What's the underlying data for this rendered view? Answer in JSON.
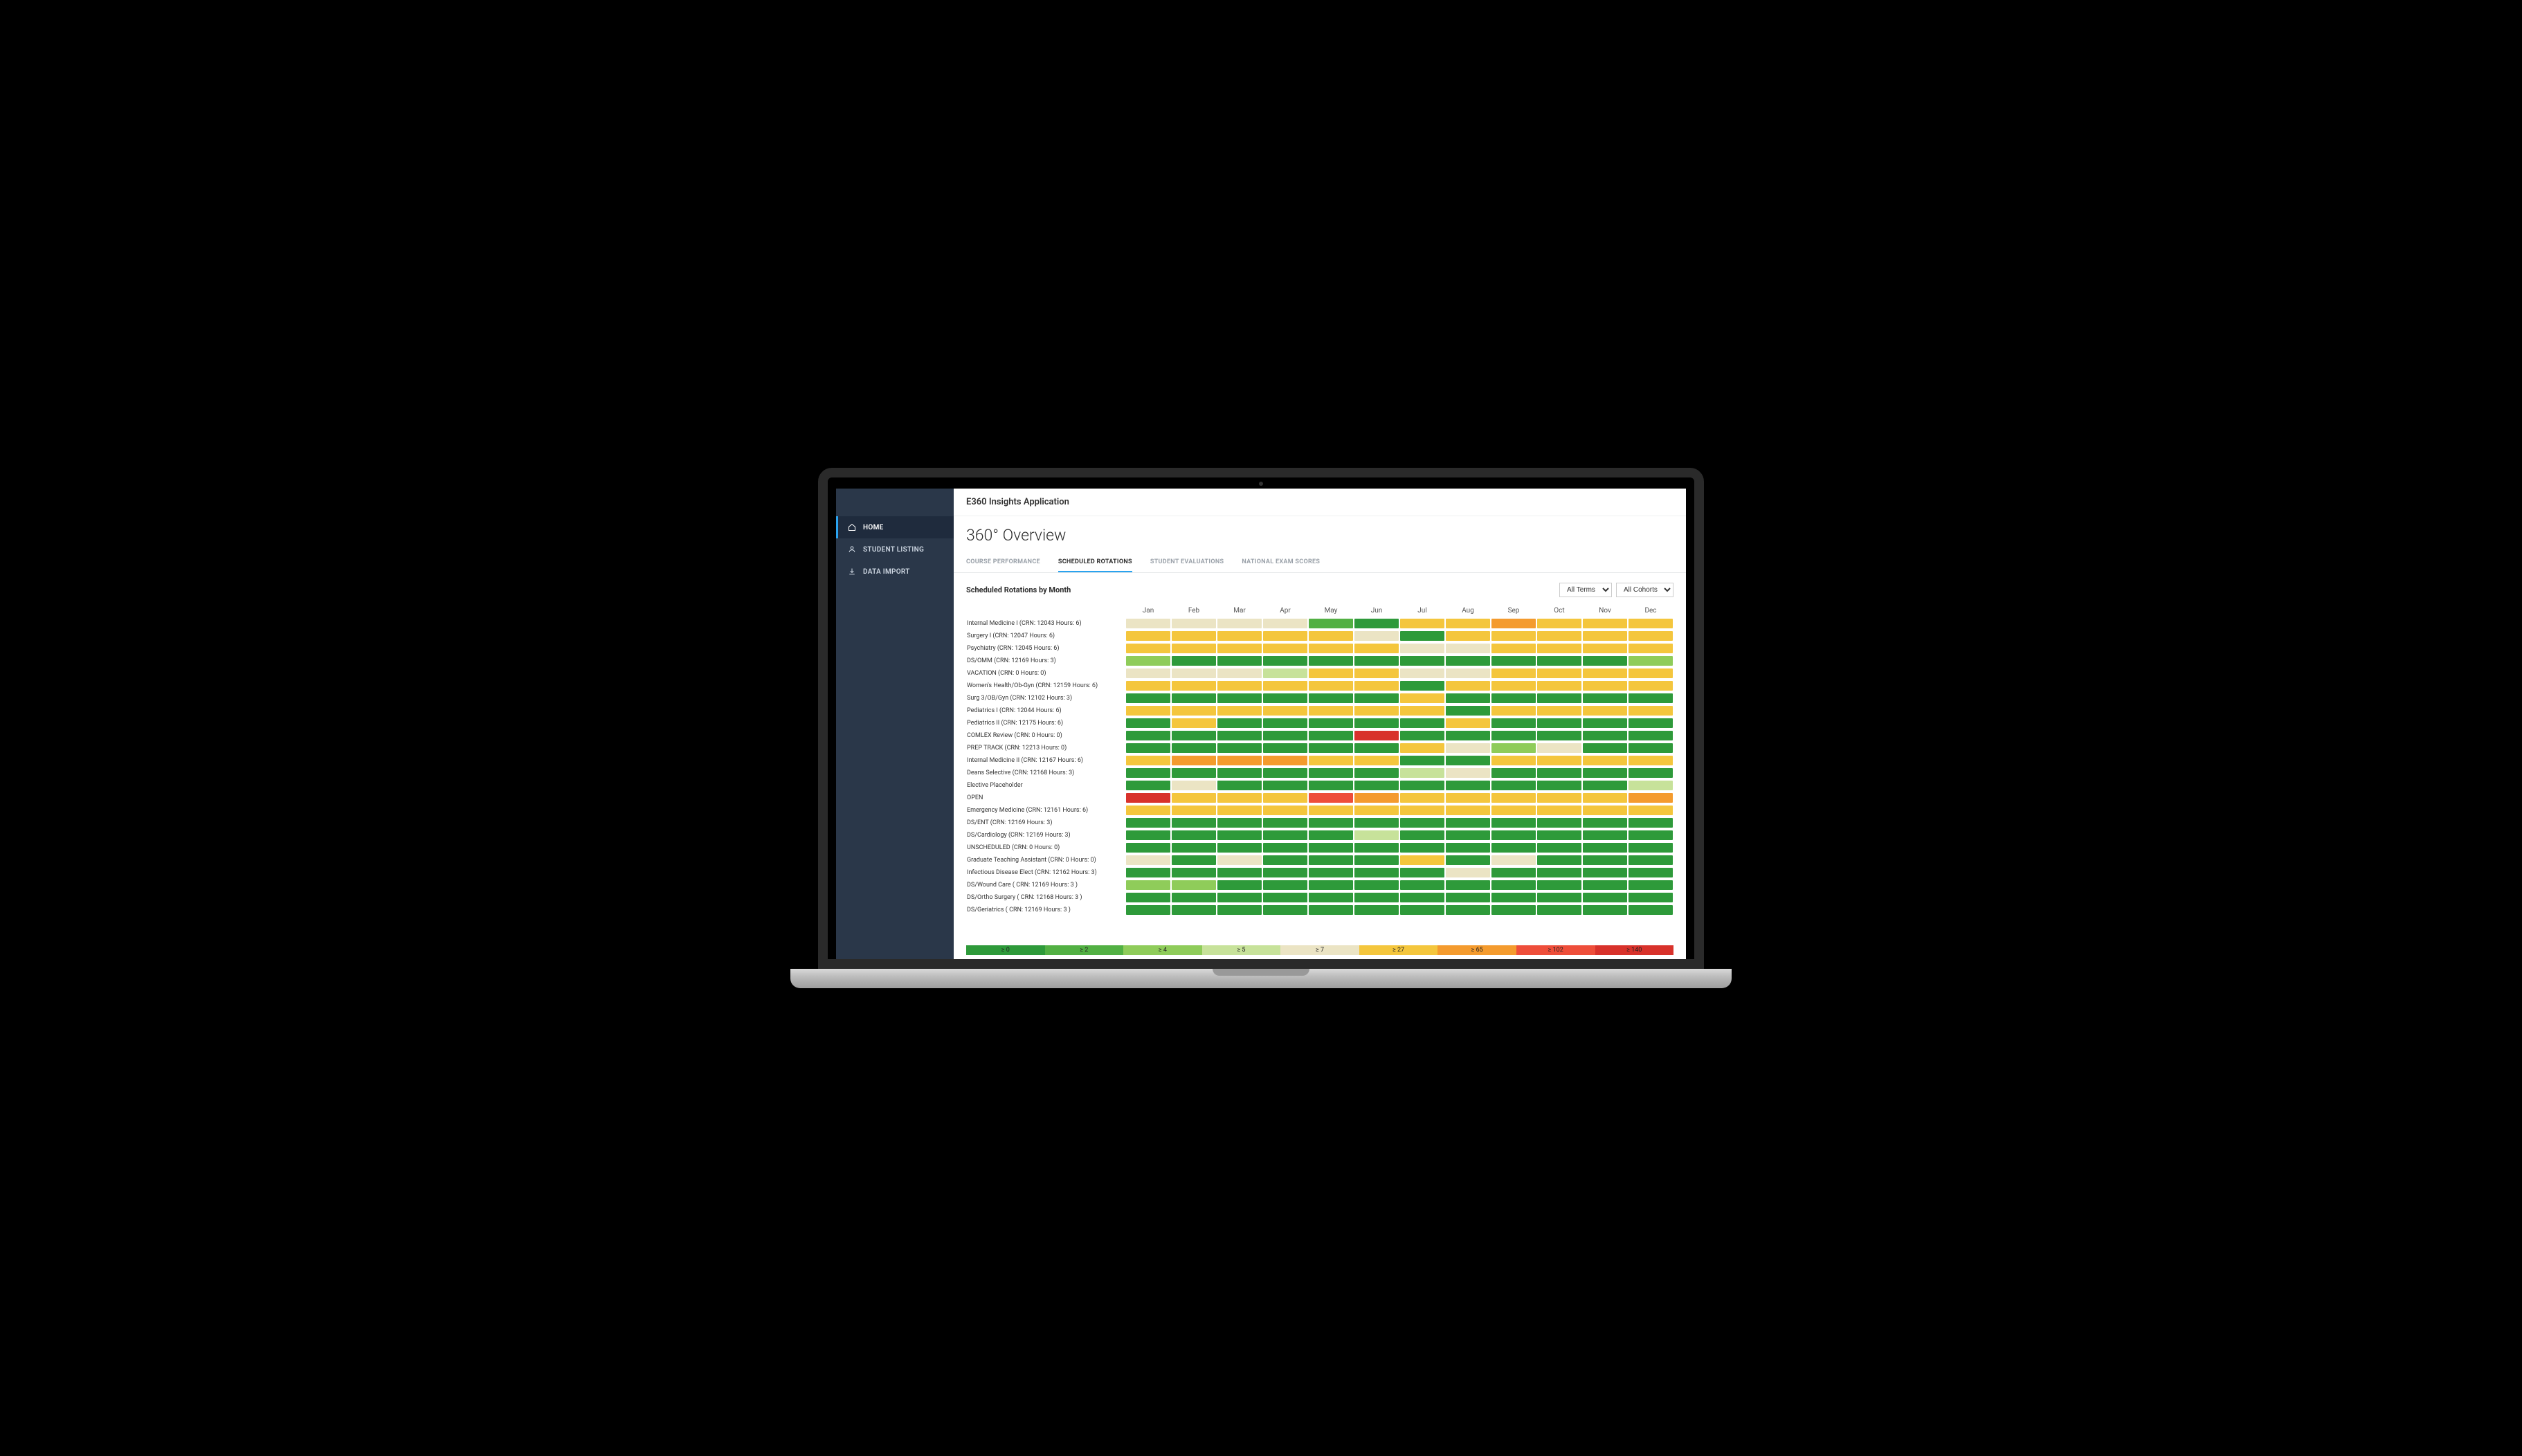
{
  "app_title": "E360 Insights Application",
  "page_title": "360° Overview",
  "sidebar": {
    "items": [
      {
        "label": "HOME",
        "icon": "home-icon",
        "active": true
      },
      {
        "label": "STUDENT LISTING",
        "icon": "people-icon",
        "active": false
      },
      {
        "label": "DATA IMPORT",
        "icon": "import-icon",
        "active": false
      }
    ]
  },
  "tabs": [
    {
      "label": "COURSE PERFORMANCE",
      "active": false
    },
    {
      "label": "SCHEDULED ROTATIONS",
      "active": true
    },
    {
      "label": "STUDENT EVALUATIONS",
      "active": false
    },
    {
      "label": "NATIONAL EXAM SCORES",
      "active": false
    }
  ],
  "section_title": "Scheduled Rotations by Month",
  "filters": {
    "terms": {
      "selected": "All Terms",
      "options": [
        "All Terms"
      ]
    },
    "cohorts": {
      "selected": "All Cohorts",
      "options": [
        "All Cohorts"
      ]
    }
  },
  "colors": {
    "c0": "#2e9a3a",
    "c2": "#52b043",
    "c4": "#8fcc5a",
    "c5": "#c7e29a",
    "c7": "#ebe4c4",
    "c27": "#f4c63d",
    "c65": "#f49b2e",
    "c102": "#ee4e3a",
    "c140": "#d8322b"
  },
  "chart_data": {
    "type": "heatmap",
    "title": "Scheduled Rotations by Month",
    "xlabel": "Month",
    "ylabel": "Rotation",
    "months": [
      "Jan",
      "Feb",
      "Mar",
      "Apr",
      "May",
      "Jun",
      "Jul",
      "Aug",
      "Sep",
      "Oct",
      "Nov",
      "Dec"
    ],
    "rows": [
      {
        "label": "Internal Medicine I (CRN: 12043 Hours: 6)",
        "codes": [
          "c7",
          "c7",
          "c7",
          "c7",
          "c2",
          "c0",
          "c27",
          "c27",
          "c65",
          "c27",
          "c27",
          "c27"
        ]
      },
      {
        "label": "Surgery I (CRN: 12047 Hours: 6)",
        "codes": [
          "c27",
          "c27",
          "c27",
          "c27",
          "c27",
          "c7",
          "c0",
          "c27",
          "c27",
          "c27",
          "c27",
          "c27"
        ]
      },
      {
        "label": "Psychiatry (CRN: 12045 Hours: 6)",
        "codes": [
          "c27",
          "c27",
          "c27",
          "c27",
          "c27",
          "c27",
          "c7",
          "c7",
          "c27",
          "c27",
          "c27",
          "c27"
        ]
      },
      {
        "label": "DS/OMM (CRN: 12169 Hours: 3)",
        "codes": [
          "c4",
          "c0",
          "c0",
          "c0",
          "c0",
          "c0",
          "c0",
          "c0",
          "c0",
          "c0",
          "c0",
          "c4"
        ]
      },
      {
        "label": "VACATION (CRN: 0 Hours: 0)",
        "codes": [
          "c7",
          "c7",
          "c7",
          "c5",
          "c27",
          "c27",
          "c7",
          "c7",
          "c27",
          "c27",
          "c27",
          "c27"
        ]
      },
      {
        "label": "Women's Health/Ob-Gyn (CRN: 12159 Hours: 6)",
        "codes": [
          "c27",
          "c27",
          "c27",
          "c27",
          "c27",
          "c27",
          "c0",
          "c27",
          "c27",
          "c27",
          "c27",
          "c27"
        ]
      },
      {
        "label": "Surg 3/OB/Gyn (CRN: 12102 Hours: 3)",
        "codes": [
          "c0",
          "c0",
          "c0",
          "c0",
          "c0",
          "c0",
          "c27",
          "c0",
          "c0",
          "c0",
          "c0",
          "c0"
        ]
      },
      {
        "label": "Pediatrics I (CRN: 12044 Hours: 6)",
        "codes": [
          "c27",
          "c27",
          "c27",
          "c27",
          "c27",
          "c27",
          "c27",
          "c0",
          "c27",
          "c27",
          "c27",
          "c27"
        ]
      },
      {
        "label": "Pediatrics II (CRN: 12175 Hours: 6)",
        "codes": [
          "c0",
          "c27",
          "c0",
          "c0",
          "c0",
          "c0",
          "c0",
          "c27",
          "c0",
          "c0",
          "c0",
          "c0"
        ]
      },
      {
        "label": "COMLEX Review (CRN: 0 Hours: 0)",
        "codes": [
          "c0",
          "c0",
          "c0",
          "c0",
          "c0",
          "c140",
          "c0",
          "c0",
          "c0",
          "c0",
          "c0",
          "c0"
        ]
      },
      {
        "label": "PREP TRACK (CRN: 12213 Hours: 0)",
        "codes": [
          "c0",
          "c0",
          "c0",
          "c0",
          "c0",
          "c0",
          "c27",
          "c7",
          "c4",
          "c7",
          "c0",
          "c0"
        ]
      },
      {
        "label": "Internal Medicine II (CRN: 12167 Hours: 6)",
        "codes": [
          "c27",
          "c65",
          "c65",
          "c65",
          "c27",
          "c27",
          "c0",
          "c0",
          "c27",
          "c27",
          "c27",
          "c27"
        ]
      },
      {
        "label": "Deans Selective (CRN: 12168 Hours: 3)",
        "codes": [
          "c0",
          "c0",
          "c0",
          "c0",
          "c0",
          "c0",
          "c5",
          "c7",
          "c0",
          "c0",
          "c0",
          "c0"
        ]
      },
      {
        "label": "Elective Placeholder",
        "codes": [
          "c0",
          "c7",
          "c0",
          "c0",
          "c0",
          "c0",
          "c0",
          "c0",
          "c0",
          "c0",
          "c0",
          "c5"
        ]
      },
      {
        "label": "OPEN",
        "codes": [
          "c140",
          "c27",
          "c27",
          "c27",
          "c102",
          "c65",
          "c27",
          "c27",
          "c27",
          "c27",
          "c27",
          "c65"
        ]
      },
      {
        "label": "Emergency Medicine (CRN: 12161 Hours: 6)",
        "codes": [
          "c27",
          "c27",
          "c27",
          "c27",
          "c27",
          "c27",
          "c27",
          "c27",
          "c27",
          "c27",
          "c27",
          "c27"
        ]
      },
      {
        "label": "DS/ENT (CRN: 12169 Hours: 3)",
        "codes": [
          "c0",
          "c0",
          "c0",
          "c0",
          "c0",
          "c0",
          "c0",
          "c0",
          "c0",
          "c0",
          "c0",
          "c0"
        ]
      },
      {
        "label": "DS/Cardiology (CRN: 12169 Hours: 3)",
        "codes": [
          "c0",
          "c0",
          "c0",
          "c0",
          "c0",
          "c5",
          "c0",
          "c0",
          "c0",
          "c0",
          "c0",
          "c0"
        ]
      },
      {
        "label": "UNSCHEDULED (CRN: 0 Hours: 0)",
        "codes": [
          "c0",
          "c0",
          "c0",
          "c0",
          "c0",
          "c0",
          "c0",
          "c0",
          "c0",
          "c0",
          "c0",
          "c0"
        ]
      },
      {
        "label": "Graduate Teaching Assistant (CRN: 0 Hours: 0)",
        "codes": [
          "c7",
          "c0",
          "c7",
          "c0",
          "c0",
          "c0",
          "c27",
          "c0",
          "c7",
          "c0",
          "c0",
          "c0"
        ]
      },
      {
        "label": "Infectious Disease Elect (CRN: 12162 Hours: 3)",
        "codes": [
          "c0",
          "c0",
          "c0",
          "c0",
          "c0",
          "c0",
          "c0",
          "c7",
          "c0",
          "c0",
          "c0",
          "c0"
        ]
      },
      {
        "label": "DS/Wound Care ( CRN: 12169 Hours: 3 )",
        "codes": [
          "c4",
          "c4",
          "c0",
          "c0",
          "c0",
          "c0",
          "c0",
          "c0",
          "c0",
          "c0",
          "c0",
          "c0"
        ]
      },
      {
        "label": "DS/Ortho Surgery ( CRN: 12168 Hours: 3 )",
        "codes": [
          "c0",
          "c0",
          "c0",
          "c0",
          "c0",
          "c0",
          "c0",
          "c0",
          "c0",
          "c0",
          "c0",
          "c0"
        ]
      },
      {
        "label": "DS/Geriatrics ( CRN: 12169 Hours: 3 )",
        "codes": [
          "c0",
          "c0",
          "c0",
          "c0",
          "c0",
          "c0",
          "c0",
          "c0",
          "c0",
          "c0",
          "c0",
          "c0"
        ]
      }
    ],
    "legend": [
      {
        "label": "≥ 0",
        "code": "c0"
      },
      {
        "label": "≥ 2",
        "code": "c2"
      },
      {
        "label": "≥ 4",
        "code": "c4"
      },
      {
        "label": "≥ 5",
        "code": "c5"
      },
      {
        "label": "≥ 7",
        "code": "c7"
      },
      {
        "label": "≥ 27",
        "code": "c27"
      },
      {
        "label": "≥ 65",
        "code": "c65"
      },
      {
        "label": "≥ 102",
        "code": "c102"
      },
      {
        "label": "≥ 140",
        "code": "c140"
      }
    ]
  }
}
